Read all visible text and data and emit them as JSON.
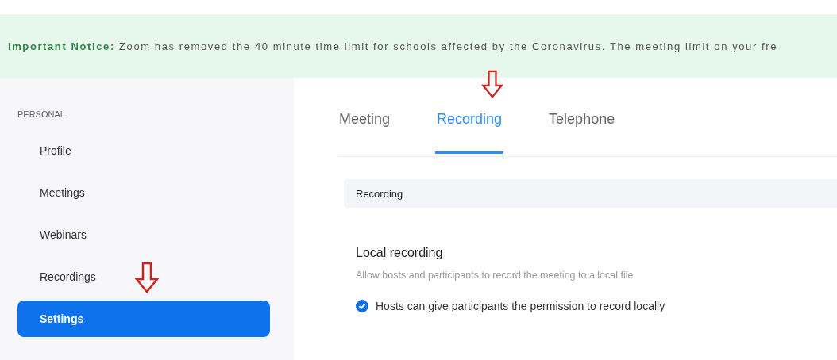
{
  "notice": {
    "text": "**Important Notice:** Zoom has removed the 40 minute time limit for schools affected by the Coronavirus. The meeting limit on your fre"
  },
  "sidebar": {
    "section": "PERSONAL",
    "items": [
      {
        "label": "Profile",
        "selected": false
      },
      {
        "label": "Meetings",
        "selected": false
      },
      {
        "label": "Webinars",
        "selected": false
      },
      {
        "label": "Recordings",
        "selected": false
      },
      {
        "label": "Settings",
        "selected": true
      }
    ]
  },
  "tabs": [
    {
      "label": "Meeting",
      "selected": false
    },
    {
      "label": "Recording",
      "selected": true
    },
    {
      "label": "Telephone",
      "selected": false
    }
  ],
  "section_header": "Recording",
  "setting": {
    "title": "Local recording",
    "description": "Allow hosts and participants to record the meeting to a local file",
    "option": {
      "label": "Hosts can give participants the permission to record locally",
      "checked": true
    }
  }
}
